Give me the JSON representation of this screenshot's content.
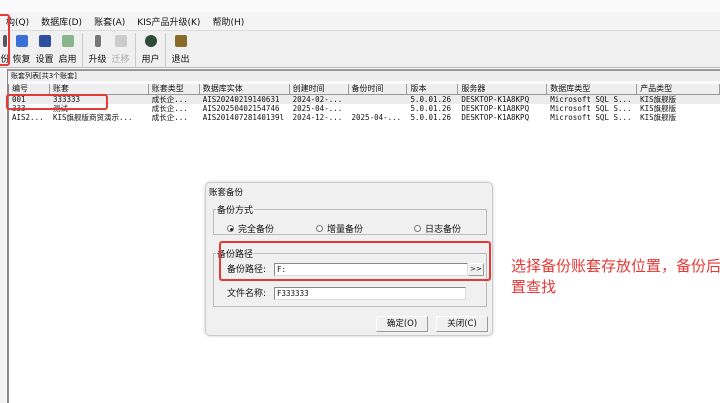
{
  "menu": [
    "构(Q)",
    "数据库(D)",
    "账套(A)",
    "KIS产品升级(K)",
    "帮助(H)"
  ],
  "toolbar": [
    {
      "label": "份",
      "icon": "backup-icon",
      "enabled": true
    },
    {
      "label": "恢复",
      "icon": "restore-icon",
      "enabled": true
    },
    {
      "label": "设置",
      "icon": "settings-icon",
      "enabled": true
    },
    {
      "label": "启用",
      "icon": "enable-icon",
      "enabled": true
    },
    {
      "label": "升级",
      "icon": "upgrade-icon",
      "enabled": true
    },
    {
      "label": "迁移",
      "icon": "migrate-icon",
      "enabled": false
    },
    {
      "label": "用户",
      "icon": "user-icon",
      "enabled": true
    },
    {
      "label": "退出",
      "icon": "exit-icon",
      "enabled": true
    }
  ],
  "list": {
    "label": "账套列表[共3个账套]",
    "columns": [
      "编号",
      "账套",
      "账套类型",
      "数据库实体",
      "创建时间",
      "备份时间",
      "版本",
      "服务器",
      "数据库类型",
      "产品类型"
    ],
    "rows": [
      [
        "001",
        "333333",
        "成长企...",
        "AIS20240219140631",
        "2024-02-...",
        "",
        "5.0.01.26",
        "DESKTOP-K1A8KPQ",
        "Microsoft SQL S...",
        "KIS旗舰版"
      ],
      [
        "333",
        "测试",
        "成长企...",
        "AIS20250402154746",
        "2025-04-...",
        "",
        "5.0.01.26",
        "DESKTOP-K1A8KPQ",
        "Microsoft SQL S...",
        "KIS旗舰版"
      ],
      [
        "AIS2...",
        "KIS旗舰版商贸演示...",
        "成长企...",
        "AIS20140728140139l",
        "2024-12-...",
        "2025-04-...",
        "5.0.01.26",
        "DESKTOP-K1A8KPQ",
        "Microsoft SQL S...",
        "KIS旗舰版"
      ]
    ]
  },
  "dialog": {
    "title": "账套备份",
    "mode_group": "备份方式",
    "modes": [
      "完全备份",
      "增量备份",
      "日志备份"
    ],
    "selected_mode": "完全备份",
    "path_group": "备份路径",
    "path_label": "备份路径:",
    "path_value": "F:",
    "browse": ">>",
    "file_label": "文件名称:",
    "file_value": "F333333",
    "ok": "确定(O)",
    "close": "关闭(C)"
  },
  "annotation": "选择备份账套存放位置，备份后置查找",
  "colors": {
    "annotation": "#e53935"
  }
}
